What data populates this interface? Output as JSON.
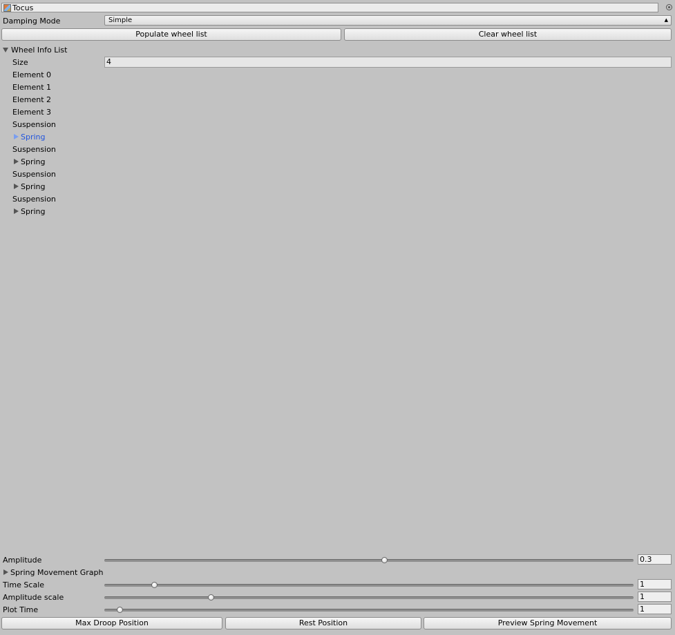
{
  "object_field": {
    "name": "Tocus",
    "icon": "prefab-cube-icon"
  },
  "damping_mode": {
    "label": "Damping Mode",
    "value": "Simple"
  },
  "buttons": {
    "populate": "Populate wheel list",
    "clear": "Clear wheel list"
  },
  "wheel_list": {
    "label": "Wheel Info List",
    "size_label": "Size",
    "size_value": "4",
    "elements": [
      "Element 0",
      "Element 1",
      "Element 2",
      "Element 3"
    ],
    "suspension_groups": [
      {
        "suspension": "Suspension",
        "spring": "Spring",
        "highlighted": true
      },
      {
        "suspension": "Suspension",
        "spring": "Spring",
        "highlighted": false
      },
      {
        "suspension": "Suspension",
        "spring": "Spring",
        "highlighted": false
      },
      {
        "suspension": "Suspension",
        "spring": "Spring",
        "highlighted": false
      }
    ]
  },
  "sliders": {
    "amplitude": {
      "label": "Amplitude",
      "value": "0.3",
      "fraction": 0.53
    },
    "graph_foldout": "Spring Movement Graph",
    "time_scale": {
      "label": "Time Scale",
      "value": "1",
      "fraction": 0.095
    },
    "amplitude_scale": {
      "label": "Amplitude scale",
      "value": "1",
      "fraction": 0.202
    },
    "plot_time": {
      "label": "Plot Time",
      "value": "1",
      "fraction": 0.03
    }
  },
  "bottom_buttons": {
    "max_droop": "Max Droop Position",
    "rest": "Rest Position",
    "preview": "Preview Spring Movement"
  },
  "colors": {
    "highlight": "#2255dd",
    "background": "#c2c2c2"
  }
}
